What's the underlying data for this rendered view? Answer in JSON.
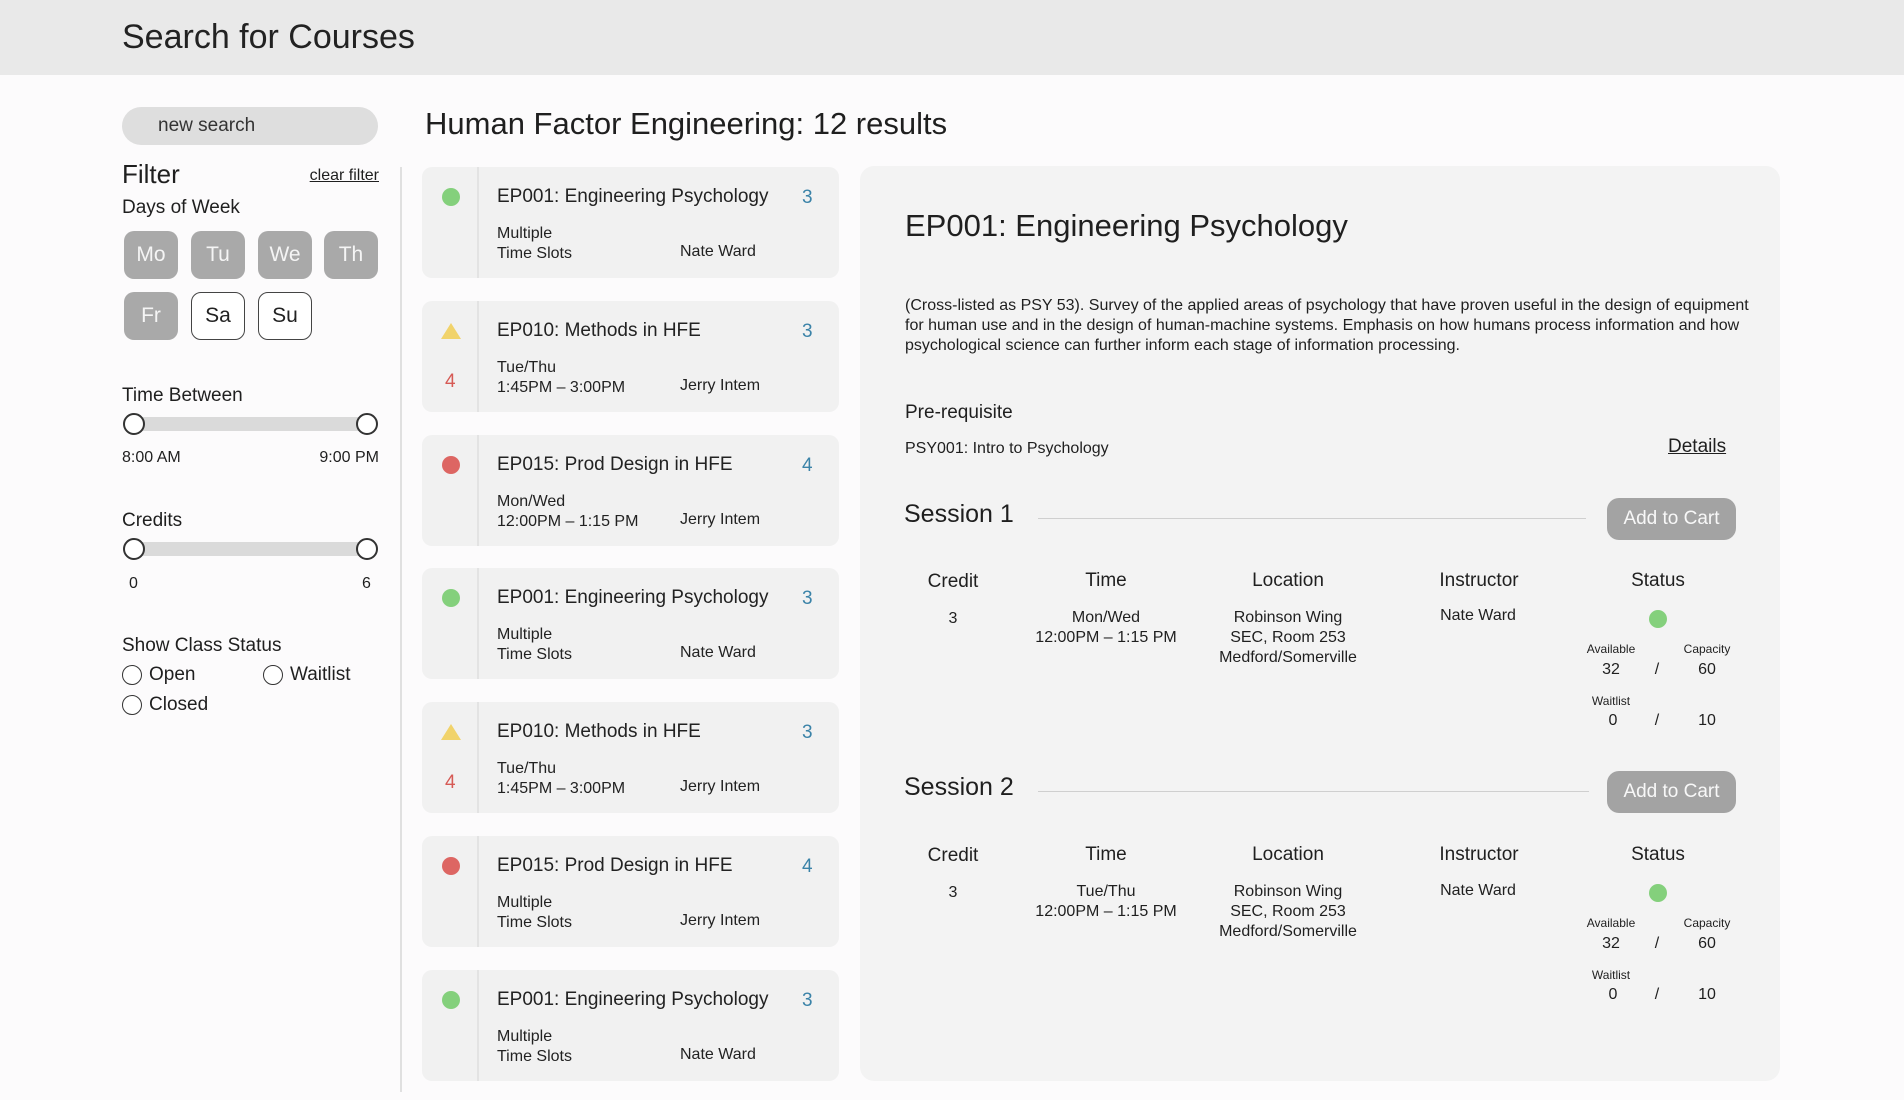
{
  "header": {
    "title": "Search for Courses"
  },
  "sidebar": {
    "search_label": "new search",
    "filter_title": "Filter",
    "clear_filter": "clear filter",
    "days_title": "Days of Week",
    "days": [
      {
        "label": "Mo",
        "selected": true
      },
      {
        "label": "Tu",
        "selected": true
      },
      {
        "label": "We",
        "selected": true
      },
      {
        "label": "Th",
        "selected": true
      },
      {
        "label": "Fr",
        "selected": true
      },
      {
        "label": "Sa",
        "selected": false
      },
      {
        "label": "Su",
        "selected": false
      }
    ],
    "time_title": "Time Between",
    "time_min": "8:00 AM",
    "time_max": "9:00 PM",
    "credits_title": "Credits",
    "credits_min": "0",
    "credits_max": "6",
    "status_title": "Show Class Status",
    "status_options": [
      "Open",
      "Waitlist",
      "Closed"
    ]
  },
  "results": {
    "heading": "Human Factor Engineering: 12 results",
    "courses": [
      {
        "title": "EP001: Engineering Psychology",
        "credits": "3",
        "days": "Multiple",
        "time": "Time Slots",
        "instructor": "Nate Ward",
        "status": "open",
        "waitlist": ""
      },
      {
        "title": "EP010: Methods in HFE",
        "credits": "3",
        "days": "Tue/Thu",
        "time": "1:45PM – 3:00PM",
        "instructor": "Jerry Intem",
        "status": "waitlist",
        "waitlist": "4"
      },
      {
        "title": "EP015: Prod Design in HFE",
        "credits": "4",
        "days": "Mon/Wed",
        "time": "12:00PM – 1:15 PM",
        "instructor": "Jerry Intem",
        "status": "closed",
        "waitlist": ""
      },
      {
        "title": "EP001: Engineering Psychology",
        "credits": "3",
        "days": "Multiple",
        "time": "Time Slots",
        "instructor": "Nate Ward",
        "status": "open",
        "waitlist": ""
      },
      {
        "title": "EP010: Methods in HFE",
        "credits": "3",
        "days": "Tue/Thu",
        "time": "1:45PM – 3:00PM",
        "instructor": "Jerry Intem",
        "status": "waitlist",
        "waitlist": "4"
      },
      {
        "title": "EP015: Prod Design in HFE",
        "credits": "4",
        "days": "Multiple",
        "time": "Time Slots",
        "instructor": "Jerry Intem",
        "status": "closed",
        "waitlist": ""
      },
      {
        "title": "EP001: Engineering Psychology",
        "credits": "3",
        "days": "Multiple",
        "time": "Time Slots",
        "instructor": "Nate Ward",
        "status": "open",
        "waitlist": ""
      }
    ]
  },
  "detail": {
    "title": "EP001: Engineering Psychology",
    "description": "(Cross-listed as PSY 53). Survey of the applied areas of psychology that have proven useful in the design of equipment for human use and in the design of human-machine systems. Emphasis on how humans process information and how psychological science can further inform each stage of information processing.",
    "prereq_title": "Pre-requisite",
    "prereq": "PSY001: Intro to Psychology",
    "details_link": "Details",
    "columns": {
      "credit": "Credit",
      "time": "Time",
      "location": "Location",
      "instructor": "Instructor",
      "status": "Status"
    },
    "sessions": [
      {
        "name": "Session 1",
        "button": "Add to Cart",
        "credit": "3",
        "days": "Mon/Wed",
        "time": "12:00PM – 1:15 PM",
        "loc1": "Robinson Wing",
        "loc2": "SEC, Room 253",
        "loc3": "Medford/Somerville",
        "instructor": "Nate Ward",
        "available_label": "Available",
        "capacity_label": "Capacity",
        "available": "32",
        "capacity": "60",
        "waitlist_label": "Waitlist",
        "waitlist": "0",
        "waitlist_max": "10",
        "slash": "/"
      },
      {
        "name": "Session 2",
        "button": "Add to Cart",
        "credit": "3",
        "days": "Tue/Thu",
        "time": "12:00PM – 1:15 PM",
        "loc1": "Robinson Wing",
        "loc2": "SEC, Room 253",
        "loc3": "Medford/Somerville",
        "instructor": "Nate Ward",
        "available_label": "Available",
        "capacity_label": "Capacity",
        "available": "32",
        "capacity": "60",
        "waitlist_label": "Waitlist",
        "waitlist": "0",
        "waitlist_max": "10",
        "slash": "/"
      }
    ]
  },
  "colors": {
    "open": "#84d07c",
    "waitlist": "#f1d36b",
    "closed": "#dd6663",
    "credits": "#3b83a8",
    "waitlist_count": "#d65a55"
  }
}
